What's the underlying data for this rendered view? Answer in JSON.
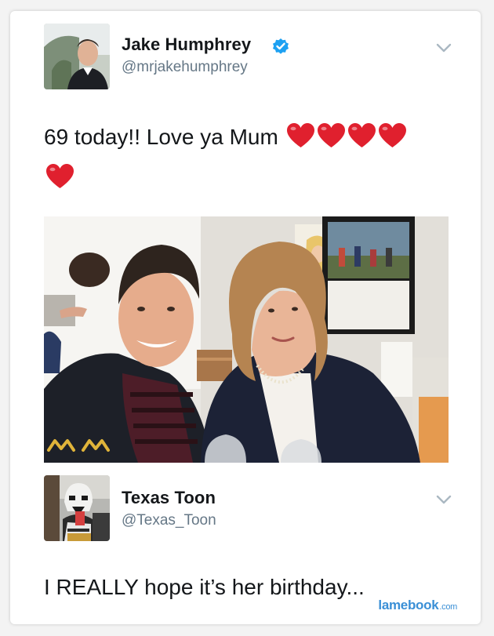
{
  "tweet1": {
    "display_name": "Jake Humphrey",
    "handle": "@mrjakehumphrey",
    "verified": true,
    "text": "69 today!! Love ya Mum",
    "emoji": "heart",
    "emoji_count": 5,
    "menu_icon": "chevron-down-icon"
  },
  "tweet2": {
    "display_name": "Texas Toon",
    "handle": "@Texas_Toon",
    "text": "I REALLY hope it’s her birthday...",
    "menu_icon": "chevron-down-icon"
  },
  "watermark": {
    "brand": "lamebook",
    "suffix": ".com"
  },
  "colors": {
    "verified_badge": "#1da1f2",
    "heart": "#e0202e",
    "handle_gray": "#657786",
    "chevron_gray": "#aab8c2",
    "watermark_blue": "#3a8fd6"
  }
}
